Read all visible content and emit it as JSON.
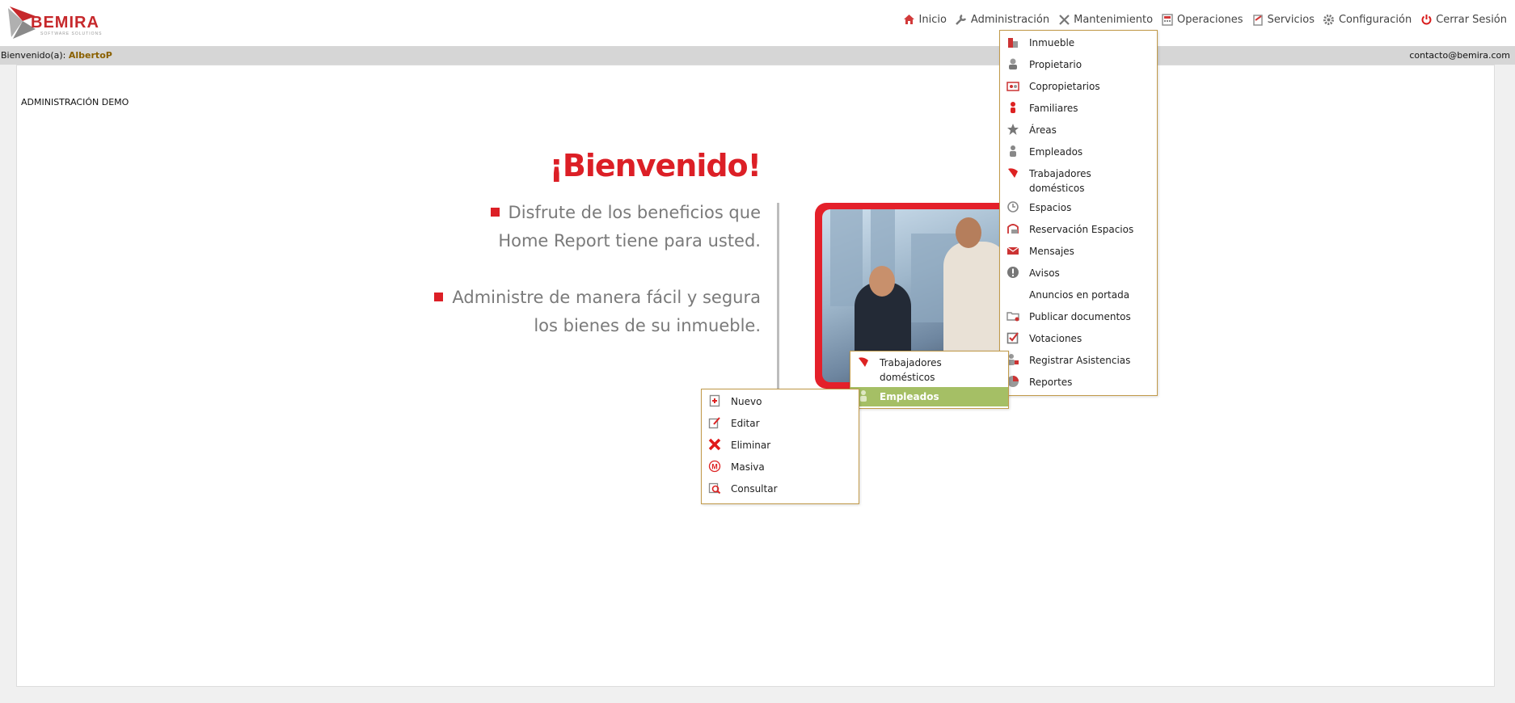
{
  "brand": {
    "name": "BEMIRA",
    "tagline": "SOFTWARE SOLUTIONS"
  },
  "nav": [
    {
      "label": "Inicio",
      "icon": "home-icon"
    },
    {
      "label": "Administración",
      "icon": "wrench-icon"
    },
    {
      "label": "Mantenimiento",
      "icon": "tools-icon"
    },
    {
      "label": "Operaciones",
      "icon": "calculator-icon"
    },
    {
      "label": "Servicios",
      "icon": "clipboard-icon"
    },
    {
      "label": "Configuración",
      "icon": "gear-icon"
    },
    {
      "label": "Cerrar Sesión",
      "icon": "power-icon"
    }
  ],
  "status": {
    "welcome_prefix": "Bienvenido(a):",
    "username": "AlbertoP",
    "contact": "contacto@bemira.com"
  },
  "content": {
    "admin_name": "ADMINISTRACIÓN DEMO",
    "welcome_title": "¡Bienvenido!",
    "bullet1_line1": "Disfrute de los beneficios que",
    "bullet1_line2": "Home Report tiene para usted.",
    "bullet2_line1": "Administre de manera fácil y segura",
    "bullet2_line2": "los bienes de su inmueble."
  },
  "admin_menu": [
    {
      "label": "Inmueble",
      "icon": "building-icon"
    },
    {
      "label": "Propietario",
      "icon": "owner-icon"
    },
    {
      "label": "Copropietarios",
      "icon": "co-owners-icon"
    },
    {
      "label": "Familiares",
      "icon": "family-icon"
    },
    {
      "label": "Áreas",
      "icon": "star-icon"
    },
    {
      "label": "Empleados",
      "icon": "employee-icon"
    },
    {
      "label": "Trabajadores domésticos",
      "icon": "domestic-worker-icon"
    },
    {
      "label": "Espacios",
      "icon": "clock-icon"
    },
    {
      "label": "Reservación Espacios",
      "icon": "reservation-icon"
    },
    {
      "label": "Mensajes",
      "icon": "mail-icon"
    },
    {
      "label": "Avisos",
      "icon": "alert-icon"
    },
    {
      "label": "Anuncios en portada",
      "icon": ""
    },
    {
      "label": "Publicar documentos",
      "icon": "folder-icon"
    },
    {
      "label": "Votaciones",
      "icon": "checkbox-icon"
    },
    {
      "label": "Registrar Asistencias",
      "icon": "attendance-icon"
    },
    {
      "label": "Reportes",
      "icon": "report-icon"
    }
  ],
  "employee_submenu": [
    {
      "label": "Trabajadores domésticos",
      "icon": "domestic-worker-icon"
    },
    {
      "label": "Empleados",
      "icon": "employee-icon",
      "active": true
    }
  ],
  "action_menu": [
    {
      "label": "Nuevo",
      "icon": "new-document-icon"
    },
    {
      "label": "Editar",
      "icon": "edit-icon"
    },
    {
      "label": "Eliminar",
      "icon": "delete-icon"
    },
    {
      "label": "Masiva",
      "icon": "bulk-icon"
    },
    {
      "label": "Consultar",
      "icon": "search-icon"
    }
  ]
}
